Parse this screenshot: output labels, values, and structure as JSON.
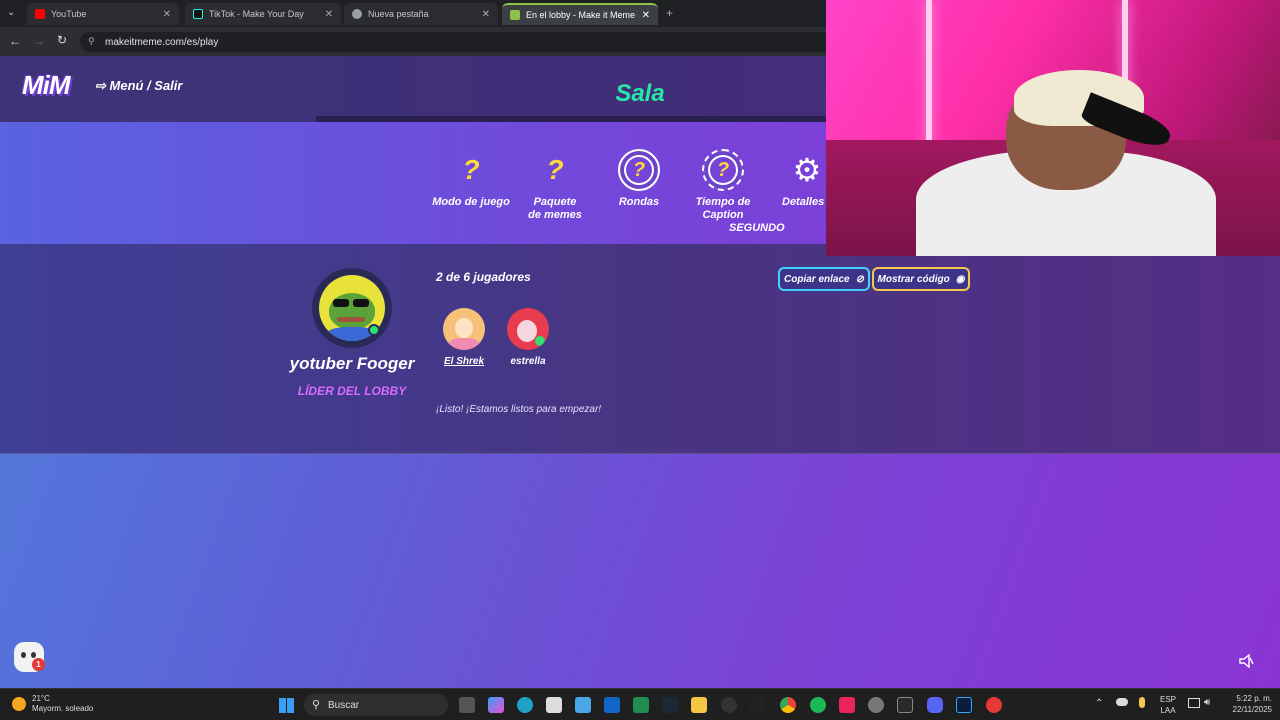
{
  "browser": {
    "tabs": [
      {
        "label": "YouTube",
        "icon": "youtube-icon",
        "color": "#ff0000",
        "active": false
      },
      {
        "label": "TikTok - Make Your Day",
        "icon": "tiktok-icon",
        "color": "#111111",
        "active": false
      },
      {
        "label": "Nueva pestaña",
        "icon": "chrome-icon",
        "color": "#9aa0a6",
        "active": false
      },
      {
        "label": "En el lobby - Make it Meme",
        "icon": "mim-icon",
        "color": "#8bc34a",
        "active": true
      }
    ],
    "url": "makeitmeme.com/es/play"
  },
  "app": {
    "logo": "MiM",
    "menu_link": "⇨ Menú / Salir",
    "title": "Sala",
    "settings": [
      {
        "label": "Modo de juego",
        "icon": "question-icon",
        "symbol": "?"
      },
      {
        "label": "Paquete\nde memes",
        "icon": "question-icon",
        "symbol": "?"
      },
      {
        "label": "Rondas",
        "icon": "question-ring-icon",
        "symbol": "?"
      },
      {
        "label": "Tiempo de\nCaption",
        "icon": "timer-icon",
        "symbol": "?"
      },
      {
        "label": "Detalles ▾",
        "icon": "gear-icon",
        "symbol": "⚙"
      }
    ],
    "timer_unit": "SEGUNDO",
    "leader": {
      "name": "yotuber Fooger",
      "role": "LÍDER DEL LOBBY"
    },
    "player_count": "2 de 6 jugadores",
    "players": [
      {
        "name": "El Shrek",
        "avatar": "shrek-avatar",
        "color": "#f6c27a"
      },
      {
        "name": "estrella",
        "avatar": "estrella-avatar",
        "color": "#e83b4e"
      }
    ],
    "status": "¡Listo! ¡Estamos listos para empezar!",
    "buttons": {
      "copy_link": "Copiar enlace",
      "show_code": "Mostrar código"
    },
    "chat_badge": "1"
  },
  "taskbar": {
    "weather_temp": "21°C",
    "weather_desc": "Mayorm. soleado",
    "search": "Buscar",
    "lang_top": "ESP",
    "lang_bottom": "LAA",
    "time": "5:22 p. m.",
    "date": "22/11/2025"
  },
  "colors": {
    "accent_title": "#27e7a6",
    "leader_role": "#d86bff",
    "gold": "#ffd83a"
  }
}
